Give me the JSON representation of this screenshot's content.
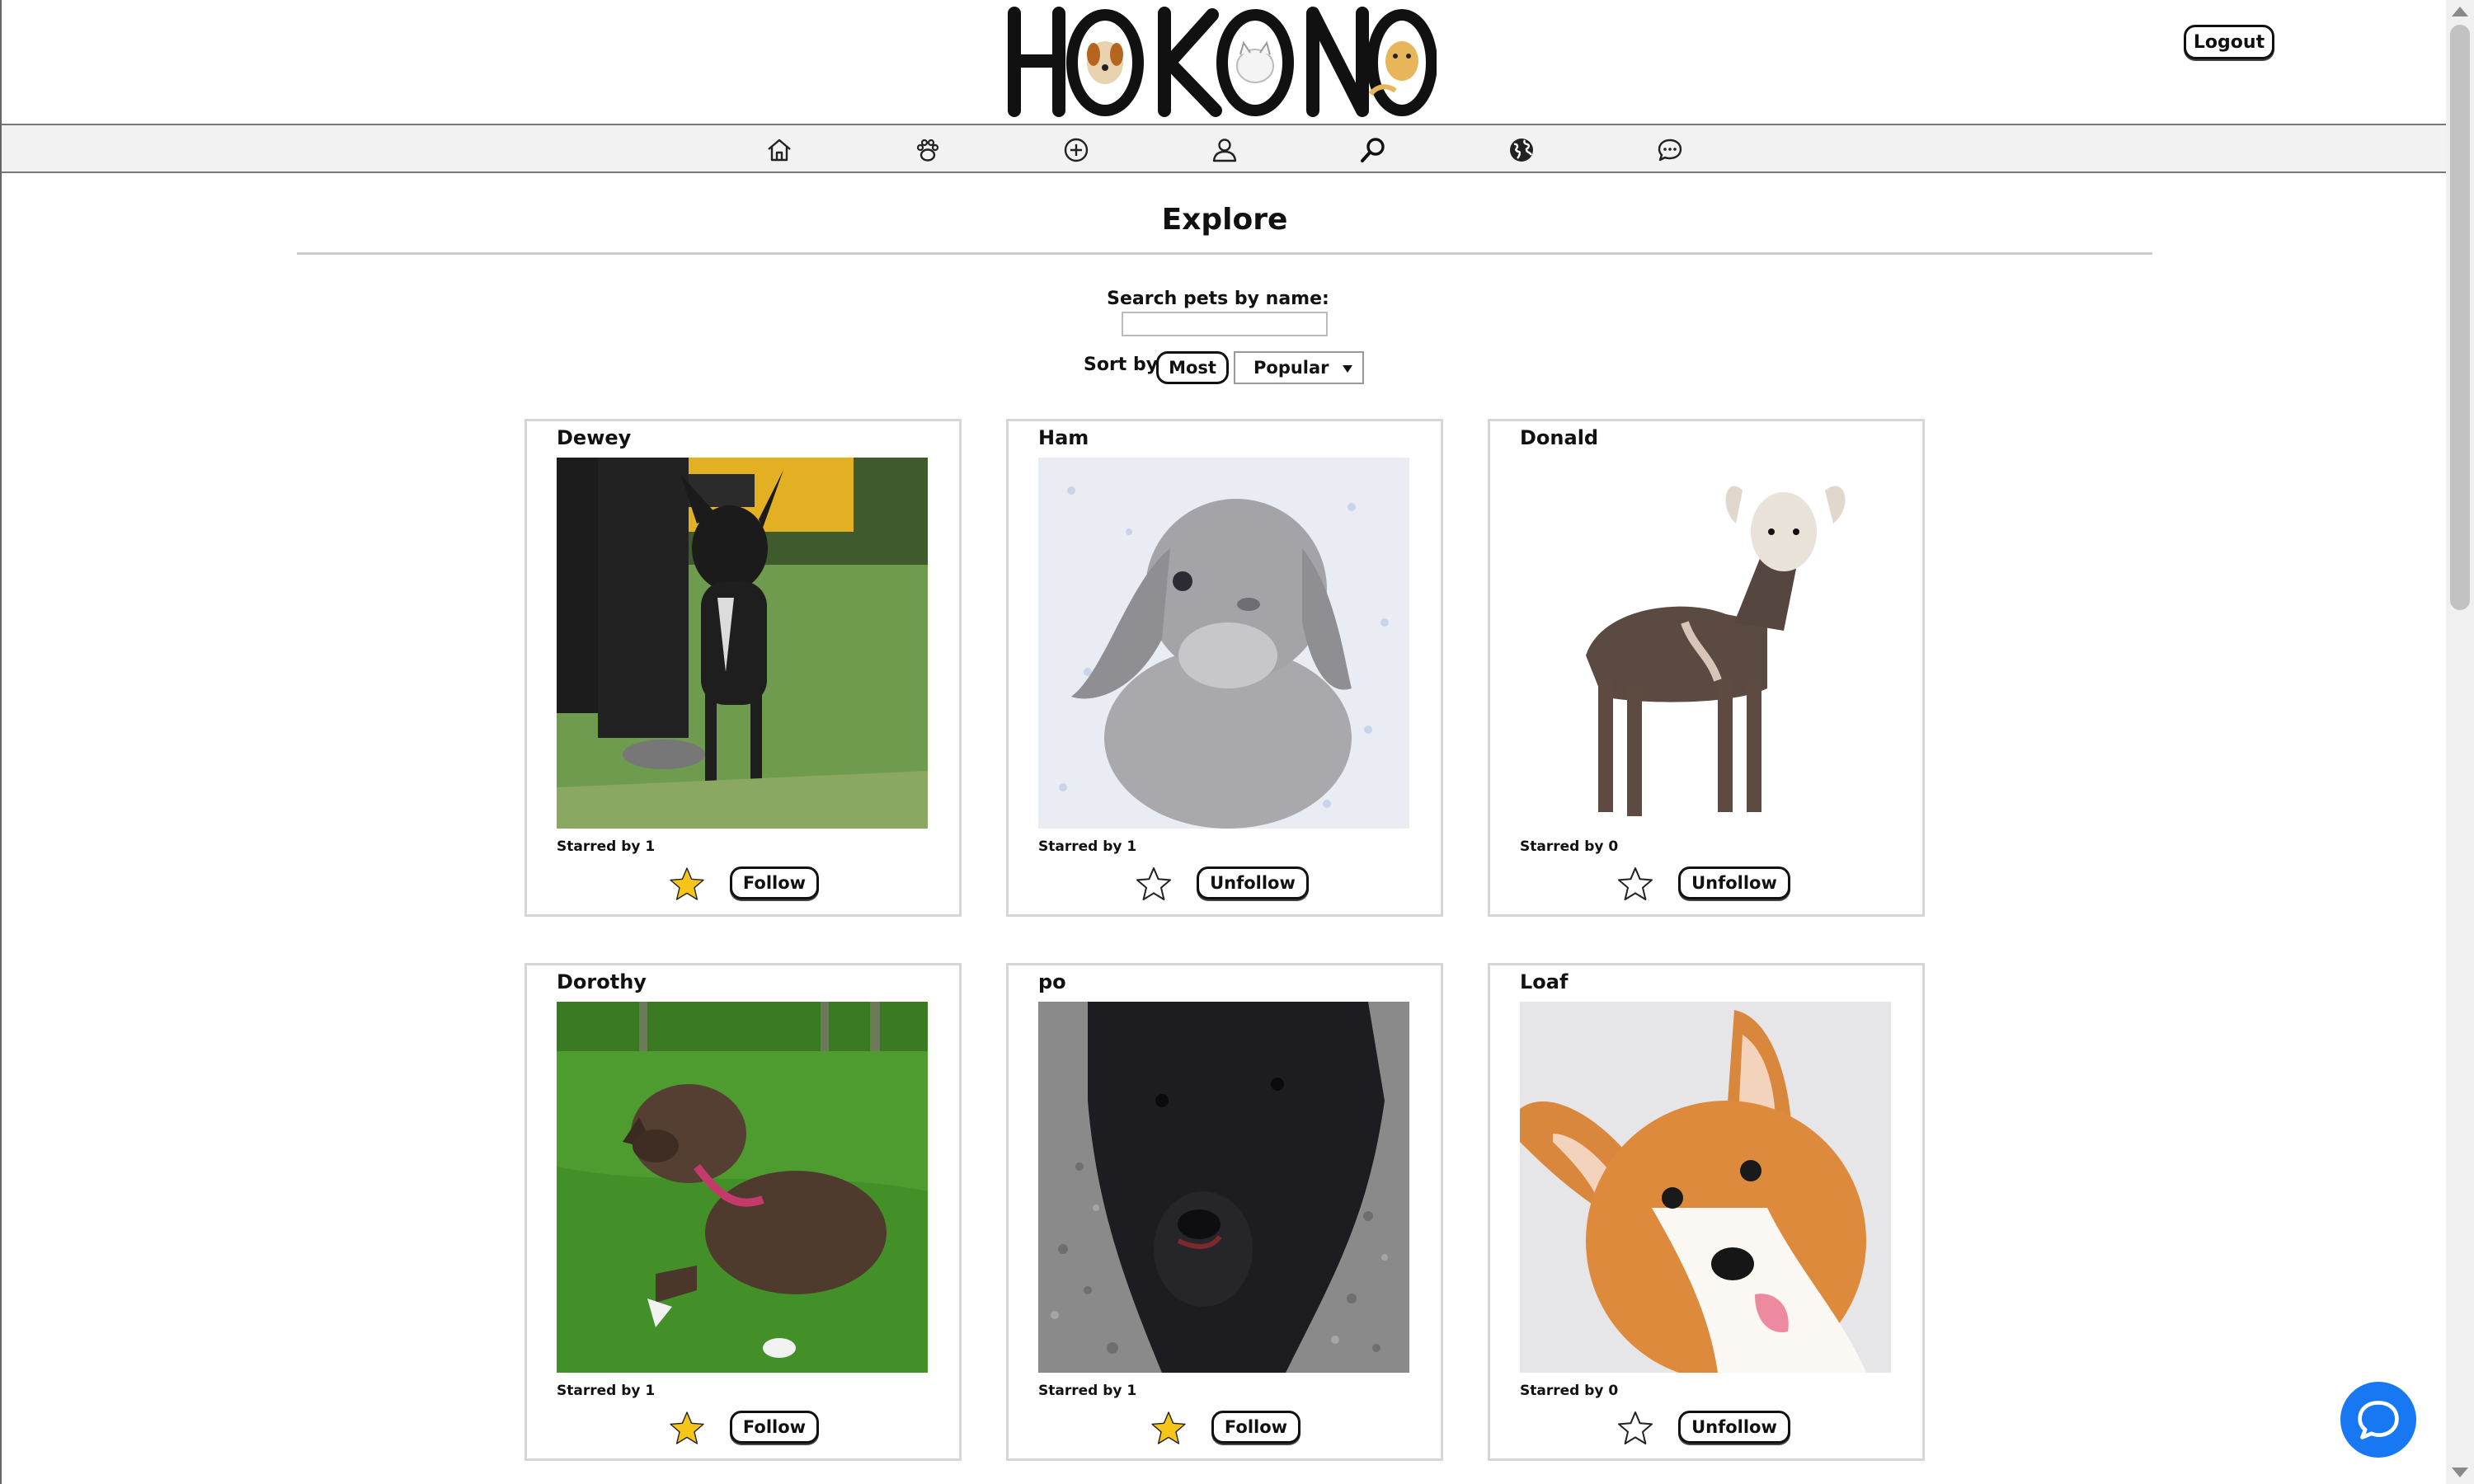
{
  "header": {
    "logo_text": "HOKONO",
    "logout_label": "Logout"
  },
  "nav": {
    "items": [
      {
        "icon": "home-icon"
      },
      {
        "icon": "paw-icon"
      },
      {
        "icon": "add-circle-icon"
      },
      {
        "icon": "user-icon"
      },
      {
        "icon": "search-icon"
      },
      {
        "icon": "globe-icon"
      },
      {
        "icon": "chat-icon"
      }
    ]
  },
  "page": {
    "title": "Explore",
    "search_label": "Search pets by name:",
    "search_value": "",
    "sort_label": "Sort by",
    "sort_button": "Most",
    "sort_select": "Popular"
  },
  "pets": [
    {
      "name": "Dewey",
      "starred": "Starred by 1",
      "star_filled": true,
      "follow_label": "Follow"
    },
    {
      "name": "Ham",
      "starred": "Starred by 1",
      "star_filled": false,
      "follow_label": "Unfollow"
    },
    {
      "name": "Donald",
      "starred": "Starred by 0",
      "star_filled": false,
      "follow_label": "Unfollow"
    },
    {
      "name": "Dorothy",
      "starred": "Starred by 1",
      "star_filled": true,
      "follow_label": "Follow"
    },
    {
      "name": "po",
      "starred": "Starred by 1",
      "star_filled": true,
      "follow_label": "Follow"
    },
    {
      "name": "Loaf",
      "starred": "Starred by 0",
      "star_filled": false,
      "follow_label": "Unfollow"
    }
  ],
  "colors": {
    "star_fill": "#f5c518",
    "chat_button": "#1877f2"
  }
}
